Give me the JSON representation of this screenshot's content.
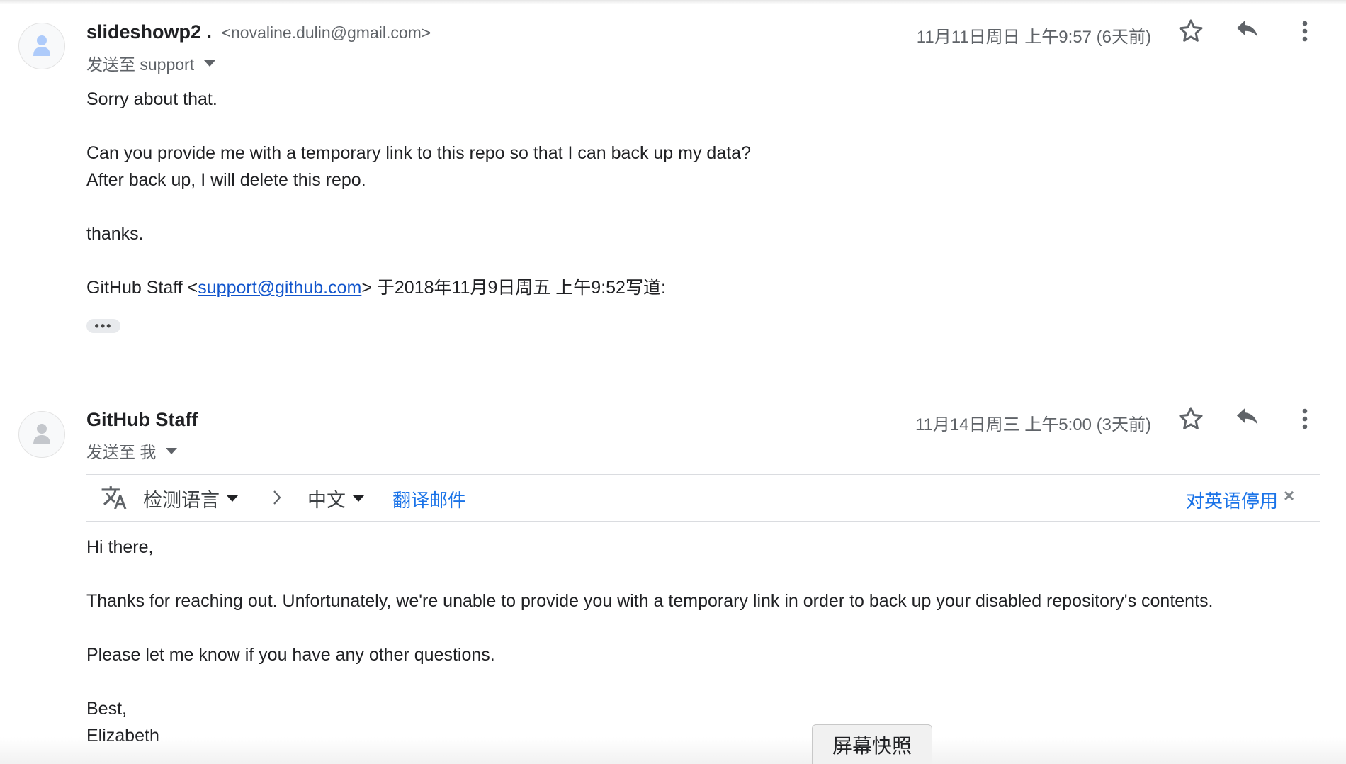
{
  "messages": [
    {
      "sender_name": "slideshowp2 .",
      "sender_email": "<novaline.dulin@gmail.com>",
      "to_line": "发送至 support",
      "date": "11月11日周日 上午9:57 (6天前)",
      "body": {
        "line1": "Sorry about that.",
        "line2": "Can you provide me with a temporary link to this repo so that I can back up my data?",
        "line3": "After back up, I will delete this repo.",
        "line4": "thanks.",
        "quote_prefix": "GitHub Staff <",
        "quote_link": "support@github.com",
        "quote_suffix": "> 于2018年11月9日周五 上午9:52写道:"
      },
      "expand_label": "•••"
    },
    {
      "sender_name": "GitHub Staff",
      "to_line": "发送至 我",
      "date": "11月14日周三 上午5:00 (3天前)",
      "translate_bar": {
        "source_language": "检测语言",
        "target_language": "中文",
        "translate_link": "翻译邮件",
        "disable_link": "对英语停用",
        "close": "×"
      },
      "body": {
        "line1": "Hi there,",
        "line2": "Thanks for reaching out. Unfortunately, we're unable to provide you with a temporary link in order to back up your disabled repository's contents.",
        "line3": "Please let me know if you have any other questions.",
        "line4": "Best,",
        "line5": "Elizabeth"
      }
    }
  ],
  "snapshot_button": "屏幕快照",
  "colors": {
    "link": "#1155cc",
    "translate_link": "#1a73e8",
    "secondary_text": "#5f6368",
    "avatar_icon_1": "#aecbfa",
    "avatar_icon_2": "#c4c7cc"
  },
  "icons": [
    "person-icon",
    "star-icon",
    "reply-icon",
    "more-vert-icon",
    "translate-icon",
    "chevron-right-icon",
    "close-icon"
  ]
}
